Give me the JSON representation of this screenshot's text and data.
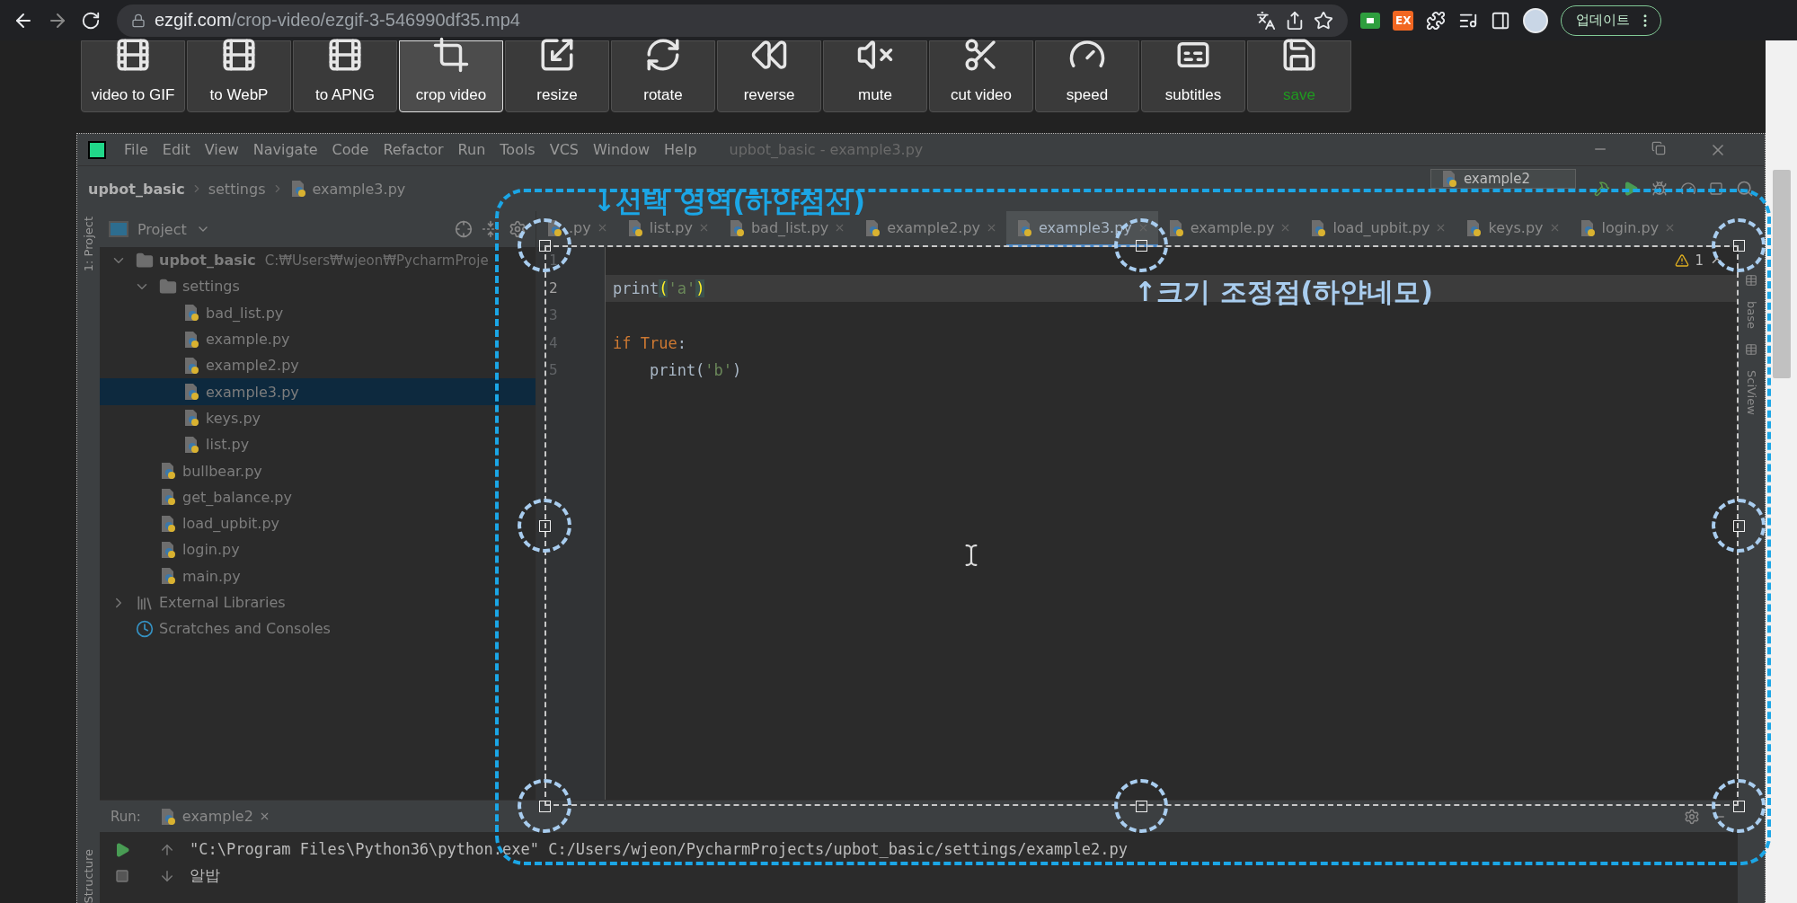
{
  "browser": {
    "host": "ezgif.com",
    "path": "/crop-video/ezgif-3-546990df35.mp4",
    "ext_badge": "EX",
    "update_label": "업데이트"
  },
  "tools": [
    {
      "label": "video to GIF",
      "kind": "film",
      "selected": false
    },
    {
      "label": "to WebP",
      "kind": "film",
      "selected": false
    },
    {
      "label": "to APNG",
      "kind": "film",
      "selected": false
    },
    {
      "label": "crop video",
      "kind": "crop",
      "selected": true
    },
    {
      "label": "resize",
      "kind": "resize",
      "selected": false
    },
    {
      "label": "rotate",
      "kind": "rotate",
      "selected": false
    },
    {
      "label": "reverse",
      "kind": "reverse",
      "selected": false
    },
    {
      "label": "mute",
      "kind": "mute",
      "selected": false
    },
    {
      "label": "cut video",
      "kind": "cut",
      "selected": false
    },
    {
      "label": "speed",
      "kind": "speed",
      "selected": false
    },
    {
      "label": "subtitles",
      "kind": "subtitles",
      "selected": false
    },
    {
      "label": "save",
      "kind": "save",
      "selected": false
    }
  ],
  "ide": {
    "menu": [
      "File",
      "Edit",
      "View",
      "Navigate",
      "Code",
      "Refactor",
      "Run",
      "Tools",
      "VCS",
      "Window",
      "Help"
    ],
    "title": "upbot_basic - example3.py",
    "breadcrumb": [
      "upbot_basic",
      "settings",
      "example3.py"
    ],
    "run_config": "example2",
    "left_strip": {
      "top": "1: Project",
      "bottom": "Structure"
    },
    "right_strip": [
      "base",
      "SciView"
    ],
    "project": {
      "title": "Project",
      "tree": [
        {
          "label": "upbot_basic",
          "path": "C:₩Users₩wjeon₩PycharmProje",
          "kind": "folder",
          "expanded": true,
          "selected": false,
          "children": [
            {
              "label": "settings",
              "kind": "folder",
              "expanded": true,
              "selected": false,
              "children": [
                {
                  "label": "bad_list.py",
                  "kind": "python",
                  "selected": false
                },
                {
                  "label": "example.py",
                  "kind": "python",
                  "selected": false
                },
                {
                  "label": "example2.py",
                  "kind": "python",
                  "selected": false
                },
                {
                  "label": "example3.py",
                  "kind": "python",
                  "selected": true
                },
                {
                  "label": "keys.py",
                  "kind": "python",
                  "selected": false
                },
                {
                  "label": "list.py",
                  "kind": "python",
                  "selected": false
                }
              ]
            },
            {
              "label": "bullbear.py",
              "kind": "python",
              "selected": false
            },
            {
              "label": "get_balance.py",
              "kind": "python",
              "selected": false
            },
            {
              "label": "load_upbit.py",
              "kind": "python",
              "selected": false
            },
            {
              "label": "login.py",
              "kind": "python",
              "selected": false
            },
            {
              "label": "main.py",
              "kind": "python",
              "selected": false
            }
          ]
        },
        {
          "label": "External Libraries",
          "kind": "library",
          "expanded": false,
          "selected": false
        },
        {
          "label": "Scratches and Consoles",
          "kind": "scratches",
          "selected": false
        }
      ]
    },
    "tabs": [
      {
        "label": ".py",
        "selected": false
      },
      {
        "label": "list.py",
        "selected": false
      },
      {
        "label": "bad_list.py",
        "selected": false
      },
      {
        "label": "example2.py",
        "selected": false
      },
      {
        "label": "example3.py",
        "selected": true
      },
      {
        "label": "example.py",
        "selected": false
      },
      {
        "label": "load_upbit.py",
        "selected": false
      },
      {
        "label": "keys.py",
        "selected": false
      },
      {
        "label": "login.py",
        "selected": false
      }
    ],
    "warning_count": "1",
    "lines": [
      {
        "number": "1",
        "current": false
      },
      {
        "number": "2",
        "current": true,
        "tokens": [
          {
            "text": "print",
            "kind": "plain"
          },
          {
            "text": "(",
            "kind": "match"
          },
          {
            "text": "'a'",
            "kind": "string"
          },
          {
            "text": ")",
            "kind": "match"
          }
        ]
      },
      {
        "number": "3",
        "current": false
      },
      {
        "number": "4",
        "current": false,
        "tokens": [
          {
            "text": "if True",
            "kind": "keyword"
          },
          {
            "text": ":",
            "kind": "plain"
          }
        ]
      },
      {
        "number": "5",
        "current": false,
        "tokens": [
          {
            "text": "    print(",
            "kind": "plain"
          },
          {
            "text": "'b'",
            "kind": "string"
          },
          {
            "text": ")",
            "kind": "plain"
          }
        ]
      }
    ],
    "run": {
      "label": "Run:",
      "tab": "example2",
      "output": [
        "\"C:\\Program Files\\Python36\\python.exe\" C:/Users/wjeon/PycharmProjects/upbot_basic/settings/example2.py",
        "알밥"
      ]
    }
  },
  "annotations": {
    "selection": "↓선택 영역(하얀점선)",
    "handles": "↑크기 조정점(하얀네모)"
  }
}
